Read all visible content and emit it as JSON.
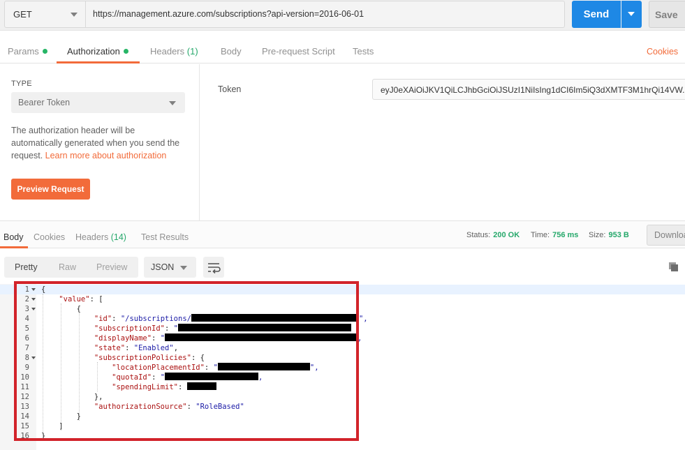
{
  "request": {
    "method": "GET",
    "url": "https://management.azure.com/subscriptions?api-version=2016-06-01",
    "send_label": "Send",
    "save_label": "Save"
  },
  "request_tabs": {
    "params": "Params",
    "authorization": "Authorization",
    "headers": "Headers",
    "headers_count": "(1)",
    "body": "Body",
    "prerequest": "Pre-request Script",
    "tests": "Tests",
    "cookies": "Cookies"
  },
  "auth": {
    "type_label": "TYPE",
    "type_value": "Bearer Token",
    "description": "The authorization header will be automatically generated when you send the request. ",
    "learn_more": "Learn more about authorization",
    "preview_button": "Preview Request",
    "token_label": "Token",
    "token_value": "eyJ0eXAiOiJKV1QiLCJhbGciOiJSUzI1NiIsIng1dCI6Im5iQ3dXMTF3M1hrQi14VW..."
  },
  "response_tabs": {
    "body": "Body",
    "cookies": "Cookies",
    "headers": "Headers",
    "headers_count": "(14)",
    "test_results": "Test Results"
  },
  "response_status": {
    "status_label": "Status:",
    "status_value": "200 OK",
    "time_label": "Time:",
    "time_value": "756 ms",
    "size_label": "Size:",
    "size_value": "953 B",
    "download_label": "Download"
  },
  "response_toolbar": {
    "pretty": "Pretty",
    "raw": "Raw",
    "preview": "Preview",
    "format": "JSON"
  },
  "code_lines": [
    {
      "n": "1",
      "t": "{"
    },
    {
      "n": "2",
      "t": "    \"value\": ["
    },
    {
      "n": "3",
      "t": "        {"
    },
    {
      "n": "4",
      "t": "            \"id\": \"/subscriptions/"
    },
    {
      "n": "5",
      "t": "            \"subscriptionId\": \""
    },
    {
      "n": "6",
      "t": "            \"displayName\": \""
    },
    {
      "n": "7",
      "t": "            \"state\": \"Enabled\","
    },
    {
      "n": "8",
      "t": "            \"subscriptionPolicies\": {"
    },
    {
      "n": "9",
      "t": "                \"locationPlacementId\": \""
    },
    {
      "n": "10",
      "t": "                \"quotaId\": \""
    },
    {
      "n": "11",
      "t": "                \"spendingLimit\": "
    },
    {
      "n": "12",
      "t": "            },"
    },
    {
      "n": "13",
      "t": "            \"authorizationSource\": \"RoleBased\""
    },
    {
      "n": "14",
      "t": "        }"
    },
    {
      "n": "15",
      "t": "    ]"
    },
    {
      "n": "16",
      "t": "}"
    }
  ],
  "colors": {
    "accent_orange": "#f26b3a",
    "send_blue": "#1e88e5",
    "status_green": "#26a86b",
    "highlight_red": "#d2232a"
  }
}
